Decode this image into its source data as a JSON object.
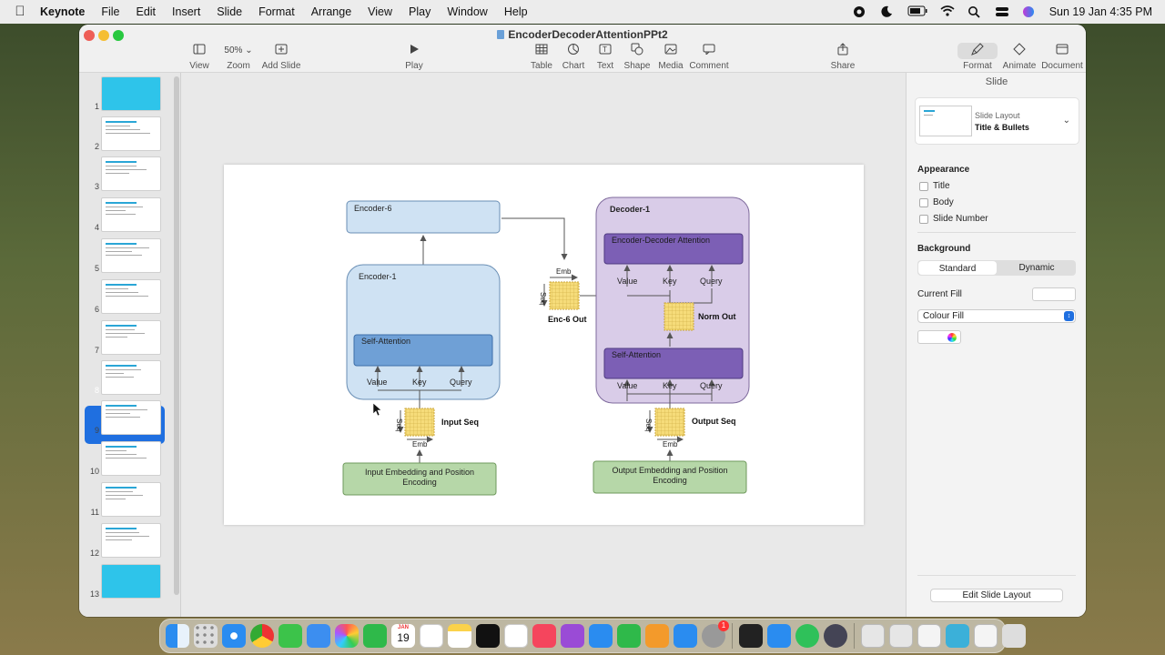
{
  "menubar": {
    "app_name": "Keynote",
    "items": [
      "File",
      "Edit",
      "Insert",
      "Slide",
      "Format",
      "Arrange",
      "View",
      "Play",
      "Window",
      "Help"
    ],
    "clock": "Sun 19 Jan  4:35 PM"
  },
  "window": {
    "title": "EncoderDecoderAttentionPPt2",
    "toolbar": {
      "view": "View",
      "zoom_value": "50%",
      "zoom": "Zoom",
      "add_slide": "Add Slide",
      "play": "Play",
      "table": "Table",
      "chart": "Chart",
      "text": "Text",
      "shape": "Shape",
      "media": "Media",
      "comment": "Comment",
      "share": "Share",
      "format": "Format",
      "animate": "Animate",
      "document": "Document"
    }
  },
  "sidebar": {
    "slide_numbers": [
      "1",
      "2",
      "3",
      "4",
      "5",
      "6",
      "7",
      "8",
      "9",
      "10",
      "11",
      "12",
      "13"
    ],
    "selected": "8"
  },
  "diagram": {
    "encoder6": "Encoder-6",
    "encoder1": "Encoder-1",
    "enc_self_attention": "Self-Attention",
    "enc_value": "Value",
    "enc_key": "Key",
    "enc_query": "Query",
    "input_seq": "Input Seq",
    "seq": "Seq",
    "emb": "Emb",
    "input_embedding_line1": "Input Embedding and Position",
    "input_embedding_line2": "Encoding",
    "enc6_emb": "Emb",
    "enc6_seq": "Seq",
    "enc6_out": "Enc-6 Out",
    "decoder1": "Decoder-1",
    "enc_dec_attention": "Encoder-Decoder Attention",
    "ed_value": "Value",
    "ed_key": "Key",
    "ed_query": "Query",
    "norm_out": "Norm Out",
    "dec_self_attention": "Self-Attention",
    "dec_value": "Value",
    "dec_key": "Key",
    "dec_query": "Query",
    "output_seq": "Output Seq",
    "out_seq": "Seq",
    "out_emb": "Emb",
    "output_embedding_line1": "Output Embedding and Position",
    "output_embedding_line2": "Encoding"
  },
  "inspector": {
    "title": "Slide",
    "layout_label": "Slide Layout",
    "layout_value": "Title & Bullets",
    "appearance": "Appearance",
    "opt_title": "Title",
    "opt_body": "Body",
    "opt_slide_number": "Slide Number",
    "background": "Background",
    "seg_standard": "Standard",
    "seg_dynamic": "Dynamic",
    "current_fill": "Current Fill",
    "colour_fill": "Colour Fill",
    "edit_slide_layout": "Edit Slide Layout"
  },
  "dock": {
    "calendar_month": "JAN",
    "calendar_day": "19",
    "badge": "1"
  },
  "colors": {
    "encoder_fill": "#cfe2f3",
    "encoder_stroke": "#6a8fb5",
    "attention_blue": "#6fa0d6",
    "decoder_fill": "#d9cce8",
    "attention_purple": "#7c5fb5",
    "embedding_green": "#b6d7a8",
    "grid_yellow": "#f6dc7a"
  }
}
